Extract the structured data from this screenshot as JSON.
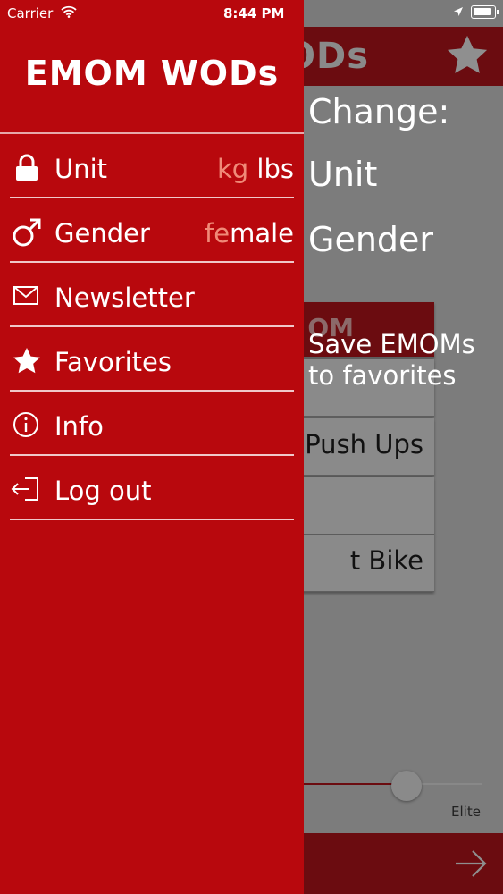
{
  "status_bar": {
    "carrier": "Carrier",
    "time": "8:44 PM"
  },
  "background": {
    "nav_title": "ODs",
    "cards": [
      "OM",
      "",
      "Push Ups",
      "",
      "t Bike"
    ],
    "slider_label": "Elite"
  },
  "tutorial": {
    "change": "Change:",
    "unit": "Unit",
    "gender": "Gender",
    "favorites_line1": "Save EMOMs",
    "favorites_line2": "to favorites"
  },
  "drawer": {
    "logo": "EMOM WODs",
    "items": [
      {
        "label": "Unit",
        "icon": "lock-icon",
        "options": [
          "kg",
          "lbs"
        ],
        "active_option": 0
      },
      {
        "label": "Gender",
        "icon": "male-symbol-icon",
        "options": [
          "fe",
          "male"
        ],
        "active_option": 0
      },
      {
        "label": "Newsletter",
        "icon": "envelope-icon"
      },
      {
        "label": "Favorites",
        "icon": "star-icon"
      },
      {
        "label": "Info",
        "icon": "info-icon"
      },
      {
        "label": "Log out",
        "icon": "logout-icon"
      }
    ]
  },
  "colors": {
    "drawer_red": "#b8080d",
    "active_option": "#f08a78",
    "bg_dark_red": "#6b0c10"
  }
}
